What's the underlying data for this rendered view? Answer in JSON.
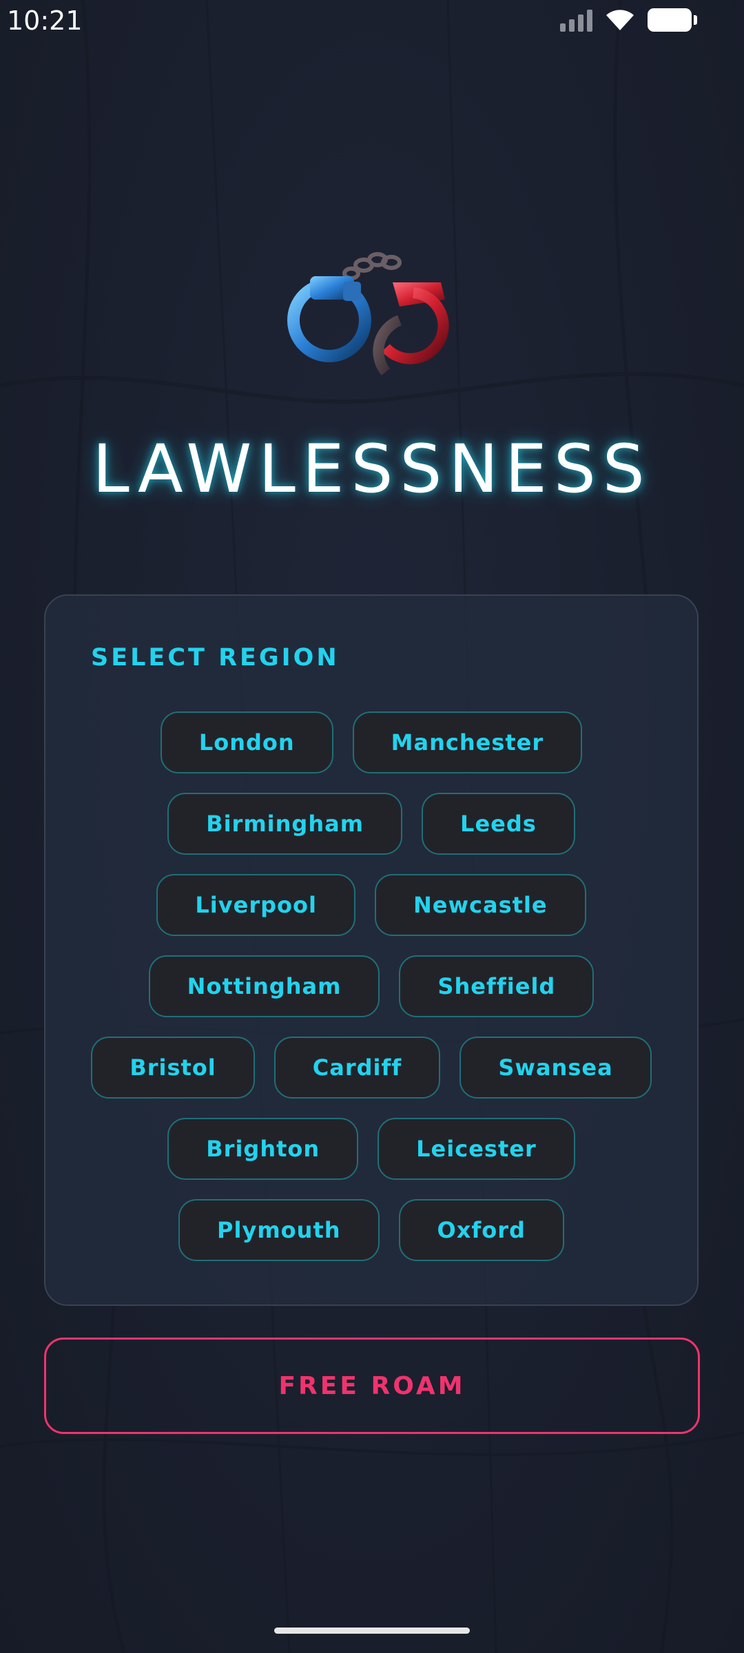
{
  "status_bar": {
    "time": "10:21",
    "icons": [
      "signal-icon",
      "wifi-icon",
      "battery-icon"
    ]
  },
  "logo": {
    "icon": "handcuffs-icon"
  },
  "app_title": "LAWLESSNESS",
  "region_card": {
    "heading": "SELECT REGION",
    "rows": [
      [
        "London",
        "Manchester"
      ],
      [
        "Birmingham",
        "Leeds"
      ],
      [
        "Liverpool",
        "Newcastle"
      ],
      [
        "Nottingham",
        "Sheffield"
      ],
      [
        "Bristol",
        "Cardiff",
        "Swansea"
      ],
      [
        "Brighton",
        "Leicester"
      ],
      [
        "Plymouth",
        "Oxford"
      ]
    ]
  },
  "free_roam_label": "FREE ROAM",
  "colors": {
    "accent": "#22d3ee",
    "danger": "#f0336d",
    "background": "#1b2030"
  }
}
